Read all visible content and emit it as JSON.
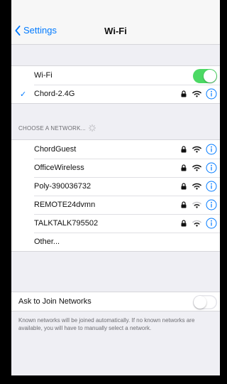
{
  "nav": {
    "back_label": "Settings",
    "title": "Wi-Fi"
  },
  "wifi_toggle": {
    "label": "Wi-Fi",
    "state": "on"
  },
  "connected_network": {
    "name": "Chord-2.4G",
    "secured": true
  },
  "choose_header": "CHOOSE A NETWORK...",
  "networks": [
    {
      "name": "ChordGuest",
      "secured": true
    },
    {
      "name": "OfficeWireless",
      "secured": true
    },
    {
      "name": "Poly-390036732",
      "secured": true
    },
    {
      "name": "REMOTE24dvmn",
      "secured": true
    },
    {
      "name": "TALKTALK795502",
      "secured": true
    }
  ],
  "other_label": "Other...",
  "ask_to_join": {
    "label": "Ask to Join Networks",
    "state": "off"
  },
  "footer_text": "Known networks will be joined automatically. If no known networks are available, you will have to manually select a network.",
  "colors": {
    "accent": "#007aff",
    "toggle_on": "#4cd964",
    "background": "#efeff4"
  }
}
